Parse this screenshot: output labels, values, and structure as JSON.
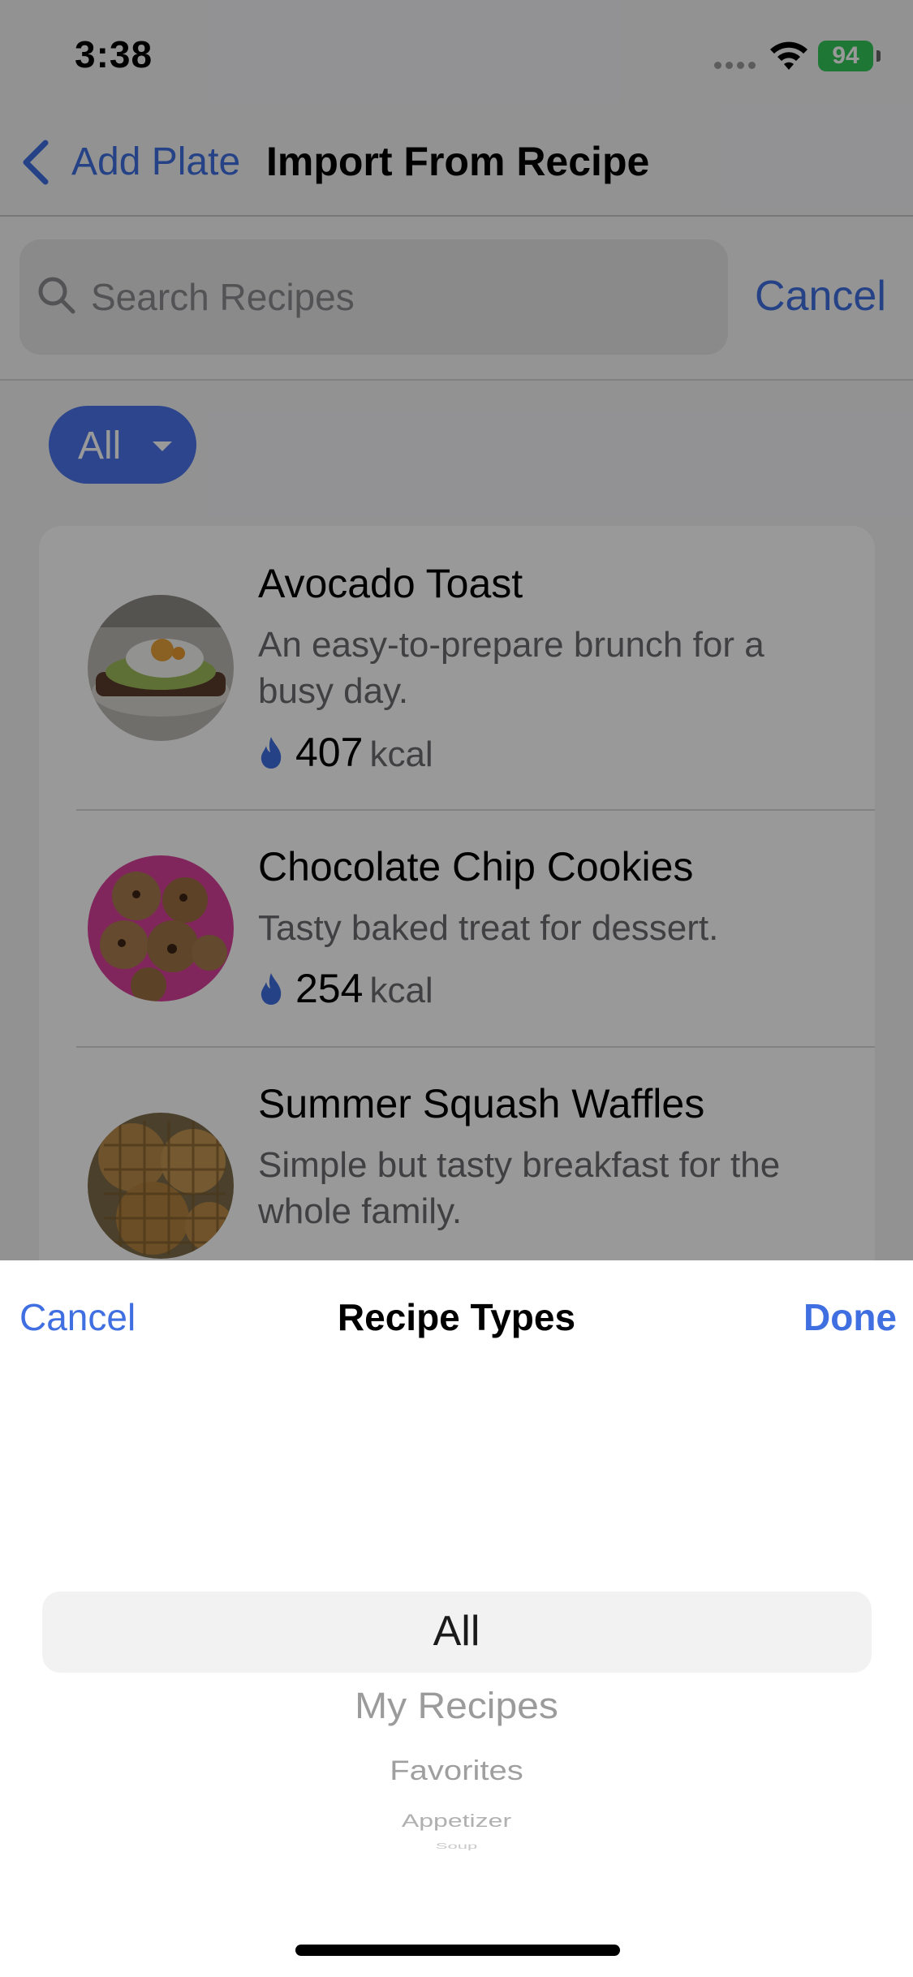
{
  "status_bar": {
    "time": "3:38",
    "battery": "94"
  },
  "nav": {
    "back_label": "Add Plate",
    "title": "Import From Recipe"
  },
  "search": {
    "placeholder": "Search Recipes",
    "cancel_label": "Cancel"
  },
  "filter": {
    "label": "All"
  },
  "recipes": [
    {
      "title": "Avocado Toast",
      "description": "An easy-to-prepare brunch for a busy day.",
      "kcal": "407",
      "unit": "kcal"
    },
    {
      "title": "Chocolate Chip Cookies",
      "description": "Tasty baked treat for dessert.",
      "kcal": "254",
      "unit": "kcal"
    },
    {
      "title": "Summer Squash Waffles",
      "description": "Simple but tasty breakfast for the whole family."
    }
  ],
  "sheet": {
    "cancel_label": "Cancel",
    "title": "Recipe Types",
    "done_label": "Done",
    "options": [
      "All",
      "My Recipes",
      "Favorites",
      "Appetizer",
      "Soup"
    ],
    "selected": "All"
  },
  "colors": {
    "accent": "#3f6fe0",
    "chip": "#4a74ea",
    "battery": "#35c759"
  }
}
